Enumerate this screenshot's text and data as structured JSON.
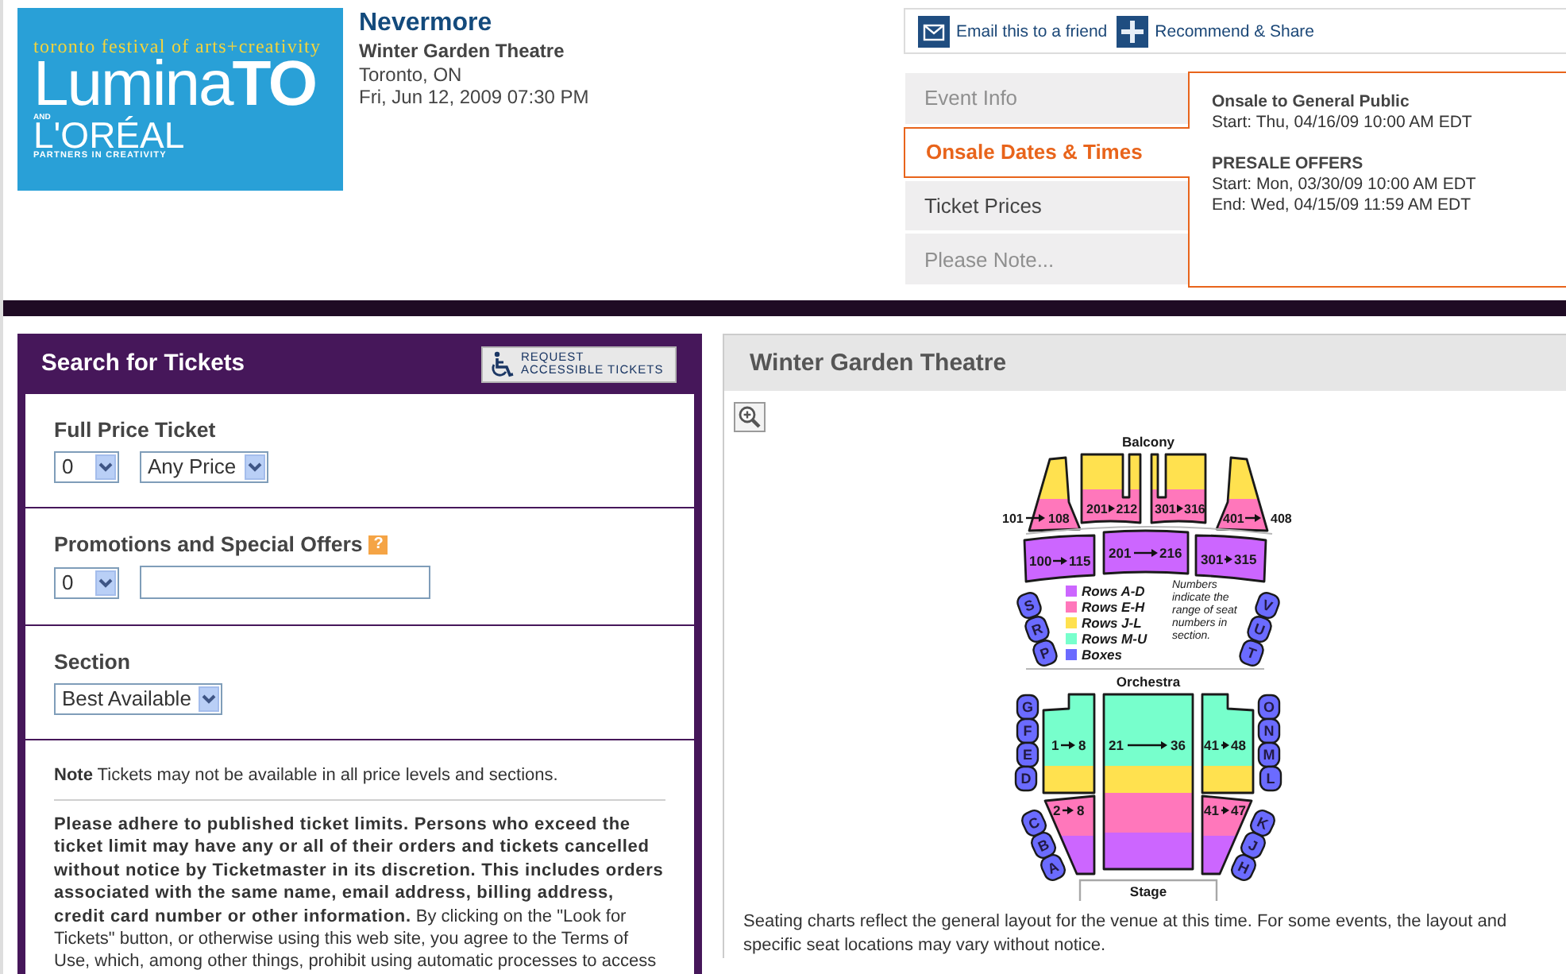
{
  "logo": {
    "tagline": "toronto festival of arts+creativity",
    "wordmark": "Lumina**TO**",
    "connector": "AND",
    "partner": "L'ORÉAL",
    "partner_tagline": "PARTNERS IN CREATIVITY"
  },
  "event": {
    "title": "Nevermore",
    "venue": "Winter Garden Theatre",
    "location": "Toronto, ON",
    "datetime": "Fri, Jun 12, 2009 07:30 PM"
  },
  "actions": [
    {
      "kind": "email",
      "label": "Email this to a friend"
    },
    {
      "kind": "share",
      "label": "Recommend & Share"
    }
  ],
  "info_tabs": [
    {
      "label": "Event Info",
      "selected": false,
      "disabled": true
    },
    {
      "label": "Onsale Dates & Times",
      "selected": true,
      "disabled": false
    },
    {
      "label": "Ticket Prices",
      "selected": false,
      "disabled": false
    },
    {
      "label": "Please Note...",
      "selected": false,
      "disabled": true
    }
  ],
  "info_panel": {
    "sections": [
      {
        "heading": "Onsale to General Public",
        "lines": [
          "Start: Thu, 04/16/09 10:00 AM EDT"
        ]
      },
      {
        "heading": "PRESALE OFFERS",
        "lines": [
          "Start: Mon, 03/30/09 10:00 AM EDT",
          "End: Wed, 04/15/09 11:59 AM EDT"
        ]
      }
    ]
  },
  "search": {
    "title": "Search for Tickets",
    "accessible_button": {
      "lines": [
        "REQUEST",
        "ACCESSIBLE TICKETS"
      ]
    },
    "groups": [
      {
        "label": "Full Price Ticket",
        "controls": [
          {
            "kind": "select",
            "value": "0"
          },
          {
            "kind": "select",
            "value": "Any Price"
          }
        ]
      },
      {
        "label": "Promotions and Special Offers",
        "help": "?",
        "controls": [
          {
            "kind": "select",
            "value": "0"
          },
          {
            "kind": "text"
          }
        ]
      },
      {
        "label": "Section",
        "controls": [
          {
            "kind": "select",
            "value": "Best Available"
          }
        ]
      }
    ],
    "note": "**Note** Tickets may not be available in all price levels and sections.",
    "policy": "**Please adhere to published ticket limits. Persons who exceed the ticket limit may have any or all of their orders and tickets cancelled without notice by Ticketmaster in its discretion. This includes orders associated with the same name, email address, billing address, credit card number or other information.** By clicking on the \"Look for Tickets\" button, or otherwise using this web site, you agree to the Terms of Use, which, among other things, prohibit using automatic processes to access"
  },
  "venue_map": {
    "title": "Winter Garden Theatre",
    "seating_chart": {
      "balcony_label": "Balcony",
      "balcony_sections": [
        {
          "from": "101",
          "to": "108"
        },
        {
          "from": "201",
          "to": "212"
        },
        {
          "from": "301",
          "to": "316"
        },
        {
          "from": "401",
          "to": "408"
        }
      ],
      "mezzanine_sections": [
        {
          "from": "100",
          "to": "115"
        },
        {
          "from": "201",
          "to": "216"
        },
        {
          "from": "301",
          "to": "315"
        }
      ],
      "legend": [
        {
          "label": "Rows A-D",
          "color": "#cc66ff"
        },
        {
          "label": "Rows E-H",
          "color": "#ff77bb"
        },
        {
          "label": "Rows J-L",
          "color": "#ffe14f"
        },
        {
          "label": "Rows M-U",
          "color": "#77ffcc"
        },
        {
          "label": "Boxes",
          "color": "#6b6bff"
        }
      ],
      "legend_note": "Numbers indicate the range of seat numbers in section.",
      "box_groups": [
        [
          "S",
          "R",
          "P"
        ],
        [
          "V",
          "U",
          "T"
        ],
        [
          "G",
          "F",
          "E",
          "D"
        ],
        [
          "O",
          "N",
          "M",
          "L"
        ],
        [
          "C",
          "B",
          "A"
        ],
        [
          "K",
          "J",
          "H"
        ]
      ],
      "orchestra_label": "Orchestra",
      "orchestra_sections": [
        {
          "from": "1",
          "to": "8"
        },
        {
          "from": "21",
          "to": "36"
        },
        {
          "from": "41",
          "to": "48"
        },
        {
          "from": "2",
          "to": "8"
        },
        {
          "from": "41",
          "to": "47"
        }
      ],
      "stage_label": "Stage"
    },
    "caption": "Seating charts reflect the general layout for the venue at this time. For some events, the layout and specific seat locations may vary without notice."
  }
}
